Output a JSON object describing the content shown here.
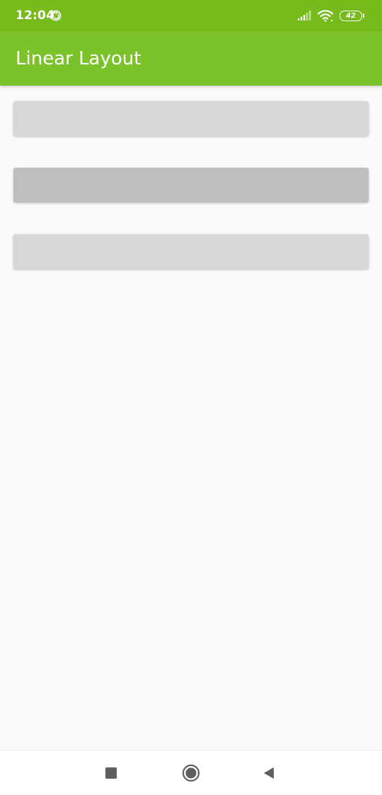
{
  "status_bar": {
    "time": "12:04",
    "battery_level": "42",
    "icons": [
      "sync-icon",
      "signal-icon",
      "wifi-icon",
      "battery-icon"
    ],
    "background": "#76BA1B"
  },
  "app_bar": {
    "title": "Linear Layout",
    "background": "#7CC22B"
  },
  "content": {
    "buttons": [
      {
        "label": "",
        "color": "#D6D7D7",
        "state": "normal"
      },
      {
        "label": "",
        "color": "#BDBEBD",
        "state": "pressed"
      },
      {
        "label": "",
        "color": "#D6D7D7",
        "state": "normal"
      }
    ]
  },
  "nav_bar": {
    "icons": [
      "recents-icon",
      "home-icon",
      "back-icon"
    ]
  }
}
